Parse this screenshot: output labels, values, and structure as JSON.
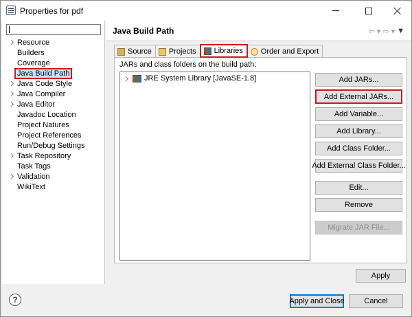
{
  "window": {
    "title": "Properties for pdf",
    "icon": "properties-icon",
    "controls": {
      "minimize": "minimize-icon",
      "maximize": "maximize-icon",
      "close": "close-icon"
    }
  },
  "filter": {
    "value": "",
    "placeholder": ""
  },
  "tree": [
    {
      "label": "Resource",
      "expandable": true
    },
    {
      "label": "Builders",
      "expandable": false
    },
    {
      "label": "Coverage",
      "expandable": false
    },
    {
      "label": "Java Build Path",
      "expandable": false,
      "selected": true
    },
    {
      "label": "Java Code Style",
      "expandable": true
    },
    {
      "label": "Java Compiler",
      "expandable": true
    },
    {
      "label": "Java Editor",
      "expandable": true
    },
    {
      "label": "Javadoc Location",
      "expandable": false
    },
    {
      "label": "Project Natures",
      "expandable": false
    },
    {
      "label": "Project References",
      "expandable": false
    },
    {
      "label": "Run/Debug Settings",
      "expandable": false
    },
    {
      "label": "Task Repository",
      "expandable": true
    },
    {
      "label": "Task Tags",
      "expandable": false
    },
    {
      "label": "Validation",
      "expandable": true
    },
    {
      "label": "WikiText",
      "expandable": false
    }
  ],
  "header": {
    "title": "Java Build Path",
    "nav": {
      "back": "back-arrow-icon",
      "back_menu": "dropdown-icon",
      "forward": "forward-arrow-icon",
      "forward_menu": "dropdown-icon",
      "view_menu": "view-menu-icon"
    }
  },
  "tabs": [
    {
      "label": "Source",
      "icon": "source-folder-icon",
      "active": false
    },
    {
      "label": "Projects",
      "icon": "projects-icon",
      "active": false
    },
    {
      "label": "Libraries",
      "icon": "libraries-icon",
      "active": true
    },
    {
      "label": "Order and Export",
      "icon": "order-export-icon",
      "active": false
    }
  ],
  "libraries": {
    "list_label": "JARs and class folders on the build path:",
    "items": [
      {
        "label": "JRE System Library [JavaSE-1.8]",
        "icon": "jre-library-icon",
        "expandable": true
      }
    ]
  },
  "buttons": {
    "add_jars": "Add JARs...",
    "add_external_jars": "Add External JARs...",
    "add_variable": "Add Variable...",
    "add_library": "Add Library...",
    "add_class_folder": "Add Class Folder...",
    "add_external_class_folder": "Add External Class Folder...",
    "edit": "Edit...",
    "remove": "Remove",
    "migrate_jar": "Migrate JAR File...",
    "apply": "Apply",
    "apply_and_close": "Apply and Close",
    "cancel": "Cancel"
  },
  "help": {
    "icon": "help-icon",
    "glyph": "?"
  }
}
